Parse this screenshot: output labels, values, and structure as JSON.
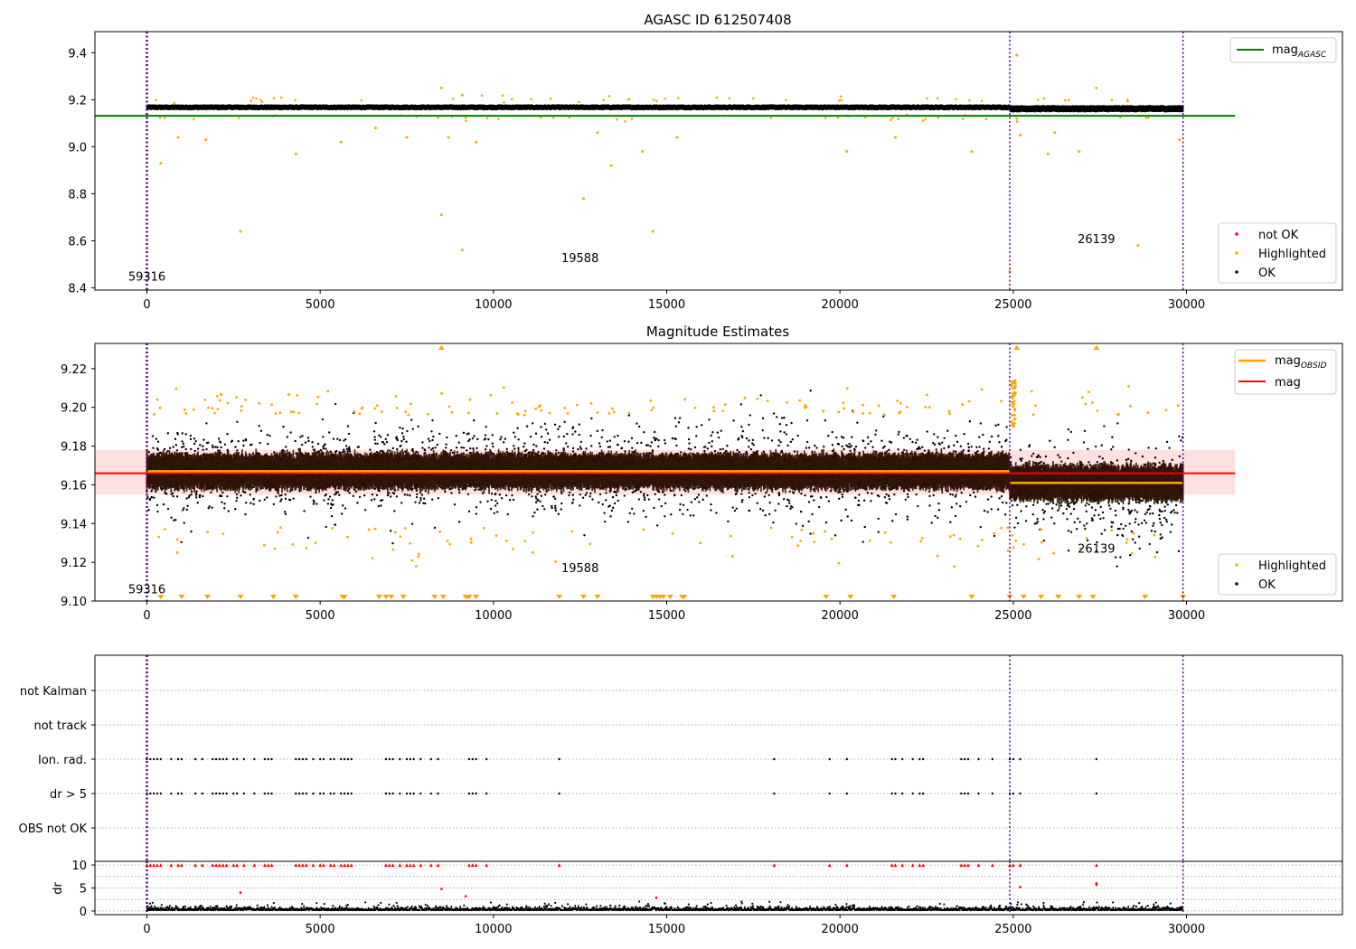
{
  "chart_data": [
    {
      "type": "scatter",
      "title": "AGASC ID 612507408",
      "xlim": [
        -1500,
        34500
      ],
      "ylim": [
        8.39,
        9.49
      ],
      "xticks": [
        "0",
        "5000",
        "10000",
        "15000",
        "20000",
        "25000",
        "30000"
      ],
      "yticks": [
        "8.4",
        "8.6",
        "8.8",
        "9.0",
        "9.2",
        "9.4"
      ],
      "grid": false,
      "vlines": [
        0,
        24900,
        29900
      ],
      "hlines": [
        {
          "name": "mag",
          "subscript": "AGASC",
          "y": 9.132,
          "x": [
            -1500,
            31400
          ],
          "color": "#008000"
        }
      ],
      "annotations": [
        {
          "text": "59316",
          "x": 0,
          "y": 8.43
        },
        {
          "text": "19588",
          "x": 12500,
          "y": 8.51
        },
        {
          "text": "26139",
          "x": 27400,
          "y": 8.59
        }
      ],
      "ok_band": {
        "segments": [
          {
            "x": [
              0,
              24900
            ],
            "center": 9.168,
            "halfwidth": 0.02
          },
          {
            "x": [
              24900,
              29900
            ],
            "center": 9.162,
            "halfwidth": 0.025
          }
        ]
      },
      "series": [
        {
          "name": "not OK",
          "color": "#ff0000",
          "values": []
        },
        {
          "name": "Highlighted",
          "color": "#ffa500",
          "values": [
            [
              400,
              8.93
            ],
            [
              900,
              9.04
            ],
            [
              1700,
              9.03
            ],
            [
              2700,
              8.64
            ],
            [
              4300,
              8.97
            ],
            [
              5600,
              9.02
            ],
            [
              6600,
              9.08
            ],
            [
              7500,
              9.04
            ],
            [
              8500,
              8.71
            ],
            [
              8500,
              9.25
            ],
            [
              8700,
              9.04
            ],
            [
              9100,
              8.56
            ],
            [
              9100,
              9.22
            ],
            [
              9500,
              9.02
            ],
            [
              12600,
              8.78
            ],
            [
              13000,
              9.06
            ],
            [
              13400,
              8.92
            ],
            [
              14300,
              8.98
            ],
            [
              14600,
              8.64
            ],
            [
              15300,
              9.04
            ],
            [
              20200,
              8.98
            ],
            [
              21600,
              9.04
            ],
            [
              23800,
              8.98
            ],
            [
              24900,
              8.47
            ],
            [
              25100,
              9.39
            ],
            [
              25200,
              9.05
            ],
            [
              26000,
              8.97
            ],
            [
              26200,
              9.06
            ],
            [
              26900,
              8.98
            ],
            [
              27400,
              9.25
            ],
            [
              28600,
              8.58
            ],
            [
              29800,
              9.03
            ]
          ]
        },
        {
          "name": "OK",
          "color": "#000000",
          "values": []
        }
      ],
      "legend_upper": [
        "mag"
      ],
      "legend_lower": [
        "not OK",
        "Highlighted",
        "OK"
      ]
    },
    {
      "type": "scatter",
      "title": "Magnitude Estimates",
      "xlim": [
        -1500,
        34500
      ],
      "ylim": [
        9.1,
        9.233
      ],
      "xticks": [
        "0",
        "5000",
        "10000",
        "15000",
        "20000",
        "25000",
        "30000"
      ],
      "yticks": [
        "9.10",
        "9.12",
        "9.14",
        "9.16",
        "9.18",
        "9.20",
        "9.22"
      ],
      "grid": false,
      "vlines": [
        0,
        24900,
        29900
      ],
      "mag_line": {
        "name": "mag",
        "y": 9.166,
        "x": [
          -1500,
          31400
        ],
        "color": "#ff0000",
        "band": [
          9.155,
          9.178
        ]
      },
      "mag_obsid": {
        "name": "mag",
        "subscript": "OBSID",
        "color": "#ffa500",
        "segments": [
          {
            "x": [
              0,
              24900
            ],
            "y": 9.167
          },
          {
            "x": [
              24900,
              29900
            ],
            "y": 9.161
          }
        ]
      },
      "annotations": [
        {
          "text": "59316",
          "x": 0,
          "y": 9.104
        },
        {
          "text": "19588",
          "x": 12500,
          "y": 9.115
        },
        {
          "text": "26139",
          "x": 27400,
          "y": 9.125
        }
      ],
      "series": [
        {
          "name": "Highlighted",
          "color": "#ffa500"
        },
        {
          "name": "OK",
          "color": "#000000"
        }
      ],
      "legend_upper": [
        "mag",
        "mag"
      ],
      "legend_lower": [
        "Highlighted",
        "OK"
      ]
    },
    {
      "type": "scatter",
      "title": "",
      "xlim": [
        -1500,
        34500
      ],
      "categories": [
        "not Kalman",
        "not track",
        "Ion. rad.",
        "dr > 5",
        "OBS not OK"
      ],
      "grid": true,
      "vlines": [
        0,
        24900,
        29900
      ],
      "flag_points_x": [
        0,
        100,
        200,
        300,
        400,
        700,
        900,
        1000,
        1400,
        1600,
        1900,
        2000,
        2100,
        2200,
        2300,
        2500,
        2600,
        2800,
        3100,
        3400,
        3500,
        3600,
        4300,
        4400,
        4500,
        4600,
        4800,
        5000,
        5100,
        5300,
        5400,
        5600,
        5700,
        5800,
        5900,
        6900,
        7000,
        7100,
        7300,
        7500,
        7600,
        7700,
        7900,
        8200,
        8400,
        9300,
        9400,
        9500,
        9800,
        11900,
        18100,
        19700,
        20200,
        21500,
        21600,
        21800,
        22100,
        22300,
        22400,
        23500,
        23600,
        23700,
        24000,
        24400,
        24900,
        25000,
        25200,
        27400
      ]
    },
    {
      "type": "scatter",
      "title": "",
      "ylabel": "dr",
      "xlim": [
        -1500,
        34500
      ],
      "ylim": [
        -0.8,
        10.8
      ],
      "yticks": [
        "0",
        "5",
        "10"
      ],
      "xticks": [
        "0",
        "5000",
        "10000",
        "15000",
        "20000",
        "25000",
        "30000"
      ],
      "grid": true,
      "vlines": [
        0,
        24900,
        29900
      ],
      "outliers": [
        [
          2700,
          4
        ],
        [
          8500,
          4.8
        ],
        [
          9200,
          3.2
        ],
        [
          14700,
          2.9
        ],
        [
          25200,
          5.2
        ],
        [
          27400,
          5.7
        ],
        [
          27400,
          6
        ]
      ]
    }
  ]
}
